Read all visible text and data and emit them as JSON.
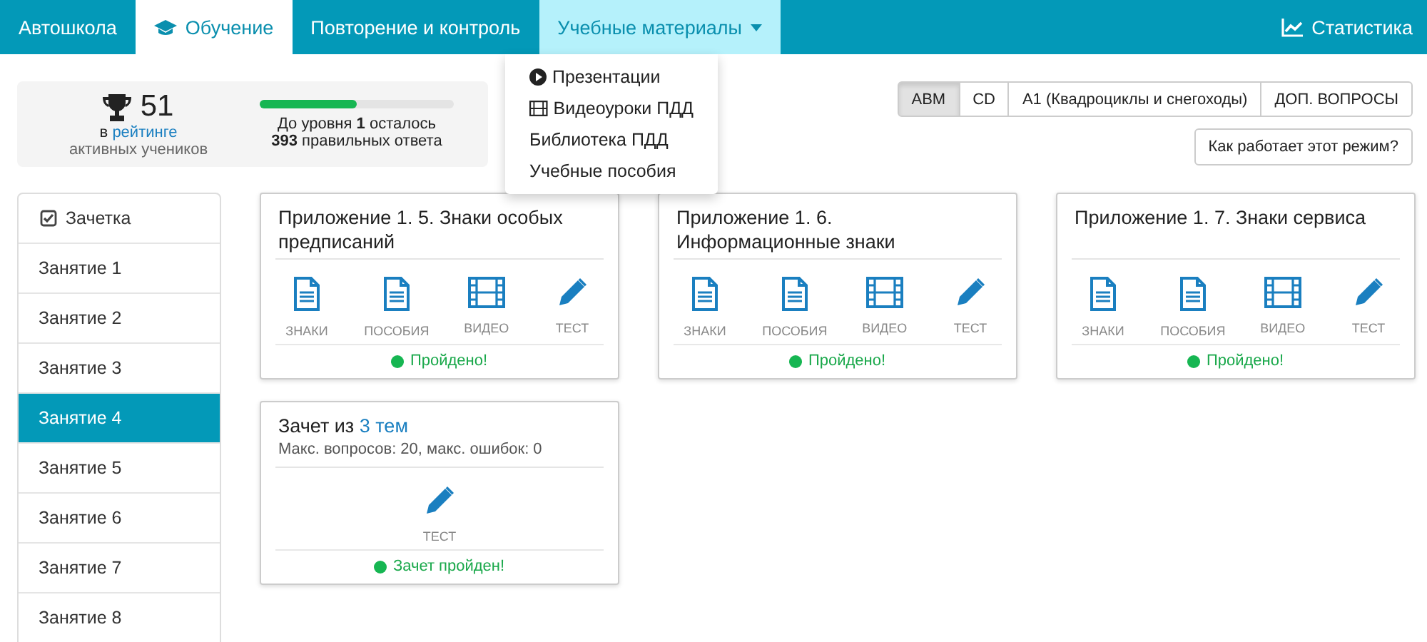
{
  "nav": {
    "brand": "Автошкола",
    "tabs": [
      {
        "label": "Обучение",
        "kind": "cap",
        "selected": true,
        "dropdown": false
      },
      {
        "label": "Повторение и контроль",
        "kind": "plain",
        "selected": false,
        "dropdown": false
      },
      {
        "label": "Учебные материалы",
        "kind": "plain",
        "selected": false,
        "dropdown": true
      }
    ],
    "right": {
      "label": "Статистика"
    }
  },
  "menu": [
    {
      "label": "Презентации",
      "kind": "play"
    },
    {
      "label": "Видеоуроки ПДД",
      "kind": "film"
    },
    {
      "label": "Библиотека ПДД",
      "kind": "plain"
    },
    {
      "label": "Учебные пособия",
      "kind": "plain"
    }
  ],
  "rating": {
    "value": "51",
    "prefix": "в",
    "link": "рейтинге",
    "caption": "активных учеников"
  },
  "progress": {
    "level": 0.5,
    "text": "До уровня **1** осталось",
    "text2": "**393** правильных ответа"
  },
  "categories": [
    {
      "label": "ABM",
      "selected": true
    },
    {
      "label": "CD",
      "selected": false
    },
    {
      "label": "A1 (Квадроциклы и снегоходы)",
      "selected": false
    },
    {
      "label": "ДОП. ВОПРОСЫ",
      "selected": false
    }
  ],
  "help_button": "Как работает этот режим?",
  "sidebar": [
    {
      "label": "Зачетка",
      "kind": "gradebook",
      "selected": false
    },
    {
      "label": "Занятие 1",
      "kind": "lesson",
      "selected": false
    },
    {
      "label": "Занятие 2",
      "kind": "lesson",
      "selected": false
    },
    {
      "label": "Занятие 3",
      "kind": "lesson",
      "selected": false
    },
    {
      "label": "Занятие 4",
      "kind": "lesson",
      "selected": true
    },
    {
      "label": "Занятие 5",
      "kind": "lesson",
      "selected": false
    },
    {
      "label": "Занятие 6",
      "kind": "lesson",
      "selected": false
    },
    {
      "label": "Занятие 7",
      "kind": "lesson",
      "selected": false
    },
    {
      "label": "Занятие 8",
      "kind": "lesson",
      "selected": false
    }
  ],
  "cards": [
    {
      "title": "Приложение 1. 5. Знаки особых предписаний",
      "links": [
        {
          "kind": "doc",
          "label": "ЗНАКИ"
        },
        {
          "kind": "doc",
          "label": "ПОСОБИЯ"
        },
        {
          "kind": "video",
          "label": "ВИДЕО"
        },
        {
          "kind": "test",
          "label": "ТЕСТ"
        }
      ],
      "status": "Пройдено!",
      "passed": true
    },
    {
      "title": "Приложение 1. 6. Информационные знаки",
      "links": [
        {
          "kind": "doc",
          "label": "ЗНАКИ"
        },
        {
          "kind": "doc",
          "label": "ПОСОБИЯ"
        },
        {
          "kind": "video",
          "label": "ВИДЕО"
        },
        {
          "kind": "test",
          "label": "ТЕСТ"
        }
      ],
      "status": "Пройдено!",
      "passed": true
    },
    {
      "title": "Приложение 1. 7. Знаки сервиса",
      "links": [
        {
          "kind": "doc",
          "label": "ЗНАКИ"
        },
        {
          "kind": "doc",
          "label": "ПОСОБИЯ"
        },
        {
          "kind": "video",
          "label": "ВИДЕО"
        },
        {
          "kind": "test",
          "label": "ТЕСТ"
        }
      ],
      "status": "Пройдено!",
      "passed": true
    },
    {
      "title": "Зачет из",
      "title_link": "3 тем",
      "subtitle": "Макс. вопросов: 20, макс. ошибок: 0",
      "links": [
        {
          "kind": "test",
          "label": "ТЕСТ"
        }
      ],
      "status": "Зачет пройден!",
      "passed": true
    }
  ]
}
